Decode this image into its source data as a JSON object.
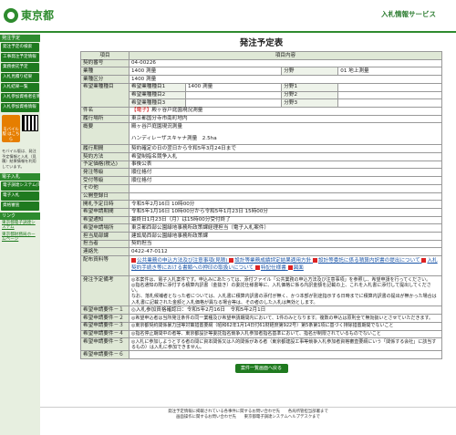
{
  "header": {
    "logo_text": "東京都",
    "service_name": "入札情報サービス"
  },
  "sidebar": {
    "section1": "発注予定",
    "items": [
      "発注予定の検索",
      "工事発注予定情報",
      "業務委託予定",
      "入札見積り結果",
      "入札結果一覧",
      "入札参加資格者名簿",
      "入札参加資格情報"
    ],
    "mobile_label": "モバイル版\nはこちら",
    "mobile_note": "モバイル版は、発注予定情報と入札（見積）結果情報を利用しています。",
    "section2": "電子入札",
    "items2": [
      "電子調達システム(TOP)",
      "電子入札",
      "資格審査"
    ],
    "section3": "リンク",
    "links": [
      "東京都電子調達システム",
      "東京都財務局ホームページ"
    ]
  },
  "main": {
    "title": "発注予定表",
    "col_item": "項目",
    "col_content": "項目内容",
    "rows": [
      {
        "label": "契約番号",
        "value": "04-00226"
      },
      {
        "label": "業種",
        "value": "1400 測量",
        "sub_l": "分野",
        "sub_v": "01 地上測量"
      },
      {
        "label": "業種区分",
        "value": "1400 測量"
      },
      {
        "label": "希望業種種目",
        "entries": [
          {
            "k": "希望業種種目1",
            "v": "1400 測量",
            "sk": "分野1",
            "sv": ""
          },
          {
            "k": "希望業種種目2",
            "v": "",
            "sk": "分野2",
            "sv": ""
          },
          {
            "k": "希望業種種目3",
            "v": "",
            "sk": "分野3",
            "sv": ""
          }
        ]
      },
      {
        "label": "件名",
        "badge": "【電子】",
        "value": "殿ヶ谷戸庭園現況測量"
      },
      {
        "label": "履行場所",
        "value": "東京都国分寺市南町地内"
      },
      {
        "label": "概要",
        "value": "殿ヶ谷戸庭園現況測量\n\nハンディレーザスキャナ測量　2.5ha"
      },
      {
        "label": "履行期間",
        "value": "契約確定の日の翌日から令和5年3月24日まで"
      },
      {
        "label": "契約方法",
        "value": "希望制指名競争入札"
      },
      {
        "label": "予定価格(税込)",
        "value": "事後公表"
      },
      {
        "label": "発注等級",
        "value": "順位格付"
      },
      {
        "label": "受付等級",
        "value": "順位格付"
      },
      {
        "label": "その他",
        "value": ""
      },
      {
        "label": "公開登録日",
        "value": ""
      },
      {
        "label": "開札予定日時",
        "value": "令和5年2月16日 10時00分"
      },
      {
        "label": "希望申請期間",
        "value": "令和5年1月16日 10時00分から令和5年1月23日 15時00分"
      },
      {
        "label": "希望通知",
        "value": "最終日1月23日（月）は15時00分受付終了"
      },
      {
        "label": "希望申請場所",
        "value": "東京都西部公園緑地事務所政策課経理担当（電子入札案件）"
      },
      {
        "label": "担当局部課",
        "value": "建設局西部公園緑地事務所政策課"
      },
      {
        "label": "担当者",
        "value": "契約担当"
      },
      {
        "label": "連絡先",
        "value": "0422-47-0112"
      }
    ],
    "docs_label": "配布資料等",
    "docs": [
      "公共業務の申込方法及び注意事項(見積)",
      "設計等業務成績評定結果適用方針",
      "設計等委託に係る積算内訳書の提出について",
      "入札契約手続き等における書類への押印の取扱いについて",
      "特記仕様書",
      "図面"
    ],
    "notes": [
      {
        "label": "発注予定備考",
        "value": "◎本案件は、電子入札案件です。申込みにあたっては、添付ファイル「公共業務の申込方法及び注意事項」を参照し、希望申請を行ってください。\n◎指名通知の際に添付する積算内訳書（金抜き）の委託仕様書等に、入札価格に係る内訳金額を記載の上、これを入札書に添付して提出してください。\nなお、落札候補者となった者については、入札書に積算内訳書の添付が無く、かつ本部が別途指示する日時までに積算内訳書の提出が無かった場合は入札書に記載された金額と入札価格が異なる場合等は、その者のした入札は無効とします。"
      },
      {
        "label": "希望申請要件－１",
        "value": "◎入札参加資格確認日：令和5年2月16日　令和5年2月1日"
      },
      {
        "label": "希望申請要件－２",
        "value": "◎希望申込者は当所発注条件の同一業種及び希望申請期間内において、1件のみとなります。複数の申込は原則全て無効扱いとさせていただきます。"
      },
      {
        "label": "希望申請要件－３",
        "value": "◎東京都契約関係暴力団等対策措置要綱（昭和62年1月14日付61財経庶第922号）第5条第1項に基づく排除措置期間でないこと"
      },
      {
        "label": "希望申請要件－４",
        "value": "◎指名停止期間中の者等、東京都設計等委託指名競争入札参加者指名基準において、指名が制限されているものでないこと"
      },
      {
        "label": "希望申請要件－５",
        "value": "◎入札に参加しようとする者の間に資本関係又は人的関係がある者（東京都建設工事等競争入札参加者資格審査要綱にいう「関係する会社」に該当するもの）は入札に参加できません。"
      },
      {
        "label": "希望申請要件－６",
        "value": ""
      }
    ],
    "back_button": "案件一覧画面へ戻る"
  },
  "footer": {
    "line1": "発注予定情報に掲載されている各事件に関するお問い合わせ先　　各局所管担当部署まで",
    "line2": "画面操作に関するお問い合わせ先　　東京都電子調達システムヘルプデスクまで"
  }
}
